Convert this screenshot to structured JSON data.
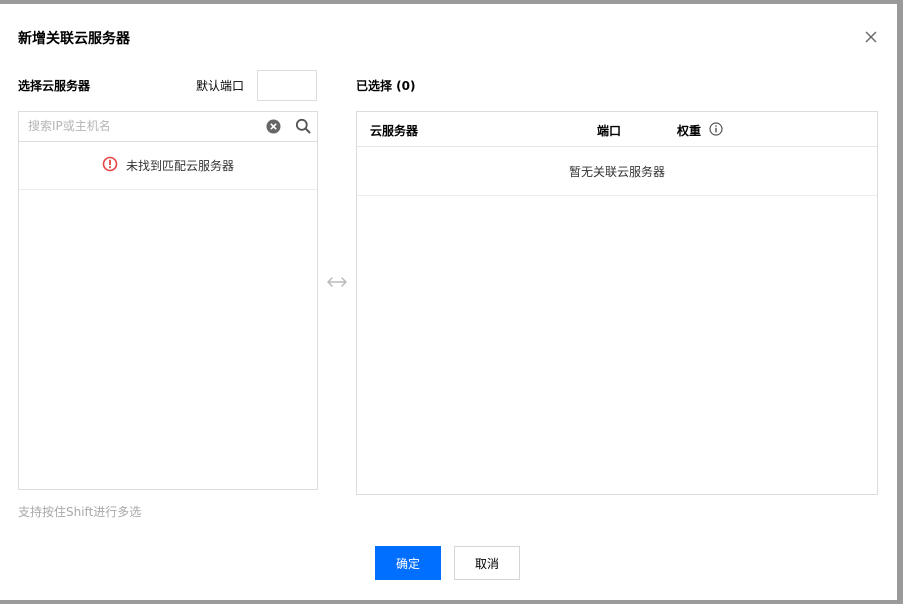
{
  "dialog": {
    "title": "新增关联云服务器"
  },
  "left": {
    "label": "选择云服务器",
    "port_label": "默认端口",
    "port_value": "",
    "search_placeholder": "搜索IP或主机名",
    "empty_text": "未找到匹配云服务器",
    "hint": "支持按住Shift进行多选"
  },
  "right": {
    "label": "已选择 (0)",
    "columns": [
      "云服务器",
      "端口",
      "权重"
    ],
    "empty_text": "暂无关联云服务器"
  },
  "footer": {
    "ok_label": "确定",
    "cancel_label": "取消"
  },
  "colors": {
    "primary": "#006eff",
    "alert": "#e54545"
  },
  "icons": [
    "close-icon",
    "clear-icon",
    "search-icon",
    "alert-icon",
    "swap-arrows-icon",
    "info-icon"
  ]
}
